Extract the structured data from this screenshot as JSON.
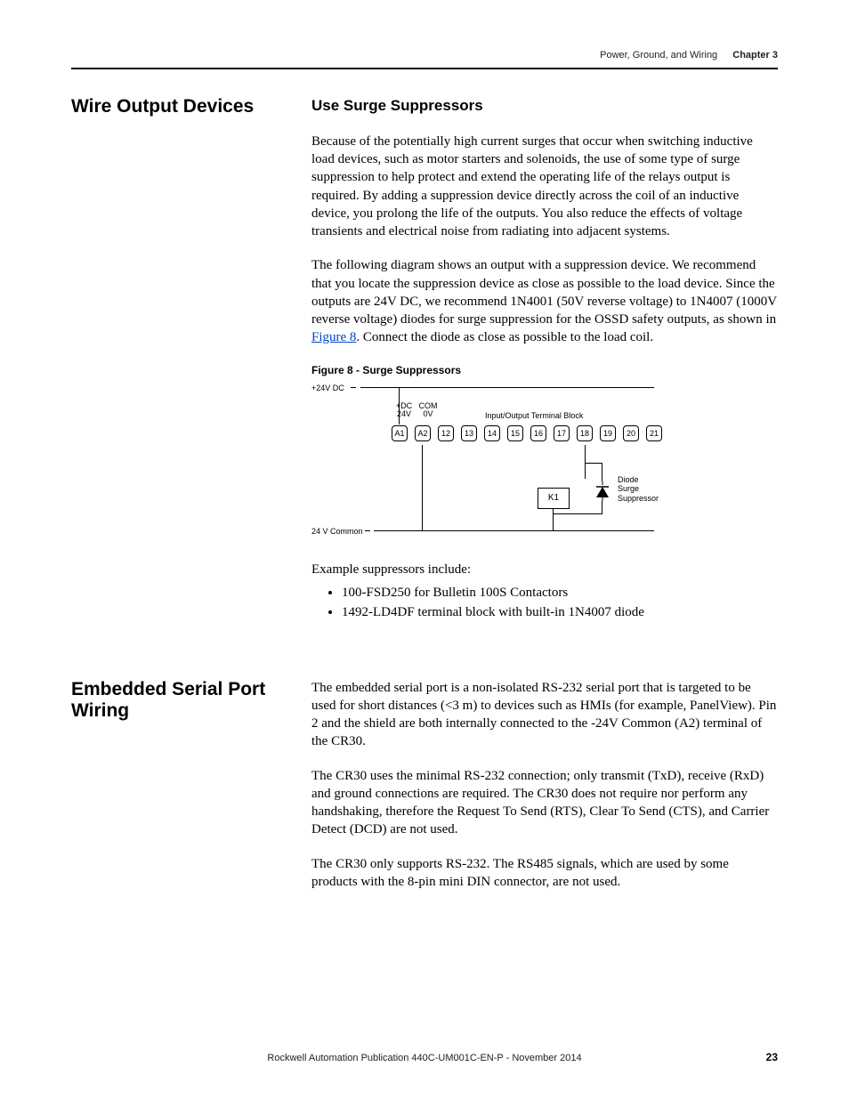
{
  "header": {
    "section": "Power, Ground, and Wiring",
    "chapter": "Chapter 3"
  },
  "section1": {
    "sidehead": "Wire Output Devices",
    "subhead": "Use Surge Suppressors",
    "p1": "Because of the potentially high current surges that occur when switching inductive load devices, such as motor starters and solenoids, the use of some type of surge suppression to help protect and extend the operating life of the relays output is required. By adding a suppression device directly across the coil of an inductive device, you prolong the life of the outputs. You also reduce the effects of voltage transients and electrical noise from radiating into adjacent systems.",
    "p2a": "The following diagram shows an output with a suppression device. We recommend that you locate the suppression device as close as possible to the load device. Since the outputs are 24V DC, we recommend 1N4001 (50V reverse voltage) to 1N4007 (1000V reverse voltage) diodes for surge suppression for the OSSD safety outputs, as shown in ",
    "p2link": "Figure 8",
    "p2b": ". Connect the diode as close as possible to the load coil.",
    "fig_caption": "Figure 8 - Surge Suppressors",
    "labels": {
      "vdc": "+24V DC",
      "dc24v": "+DC 24V",
      "com0v": "COM 0V",
      "io_block": "Input/Output Terminal Block",
      "diode1": "Diode",
      "diode2": "Surge",
      "diode3": "Suppressor",
      "k1": "K1",
      "common": "24 V Common"
    },
    "terminals": [
      "A1",
      "A2",
      "12",
      "13",
      "14",
      "15",
      "16",
      "17",
      "18",
      "19",
      "20",
      "21"
    ],
    "examples_intro": "Example suppressors include:",
    "examples": [
      "100-FSD250 for Bulletin 100S Contactors",
      "1492-LD4DF terminal block with built-in 1N4007 diode"
    ]
  },
  "section2": {
    "sidehead": "Embedded Serial Port Wiring",
    "p1": "The embedded serial port is a non-isolated RS-232 serial port that is targeted to be used for short distances (<3 m) to devices such as HMIs (for example, PanelView). Pin 2 and the shield are both internally connected to the -24V Common (A2) terminal of the CR30.",
    "p2": "The CR30 uses the minimal RS-232 connection; only transmit (TxD), receive (RxD) and ground connections are required. The CR30 does not require nor perform any handshaking, therefore the Request To Send (RTS), Clear To Send (CTS), and Carrier Detect (DCD) are not used.",
    "p3": "The CR30 only supports RS-232. The RS485 signals, which are used by some products with the 8-pin mini DIN connector, are not used."
  },
  "footer": {
    "pub": "Rockwell Automation Publication 440C-UM001C-EN-P - November 2014",
    "page": "23"
  }
}
